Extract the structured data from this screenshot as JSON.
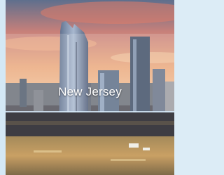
{
  "tile": {
    "label": "New Jersey"
  },
  "colors": {
    "page_background": "#dcecf6",
    "label_text": "#ffffff"
  }
}
